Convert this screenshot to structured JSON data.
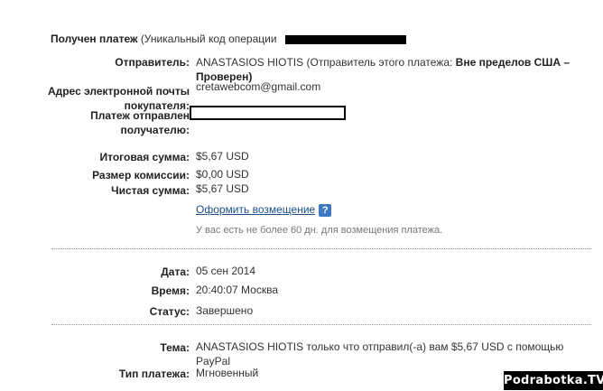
{
  "header": {
    "received": "Получен платеж",
    "unique_code": "(Уникальный код операции"
  },
  "sender": {
    "label": "Отправитель:",
    "name": "ANASTASIOS HIOTIS",
    "note_prefix": "(Отправитель этого платежа:",
    "status_bold_1": "Вне пределов США –",
    "status_bold_2": "Проверен)"
  },
  "email": {
    "label_line1": "Адрес электронной почты",
    "label_line2": "покупателя:",
    "value": "cretawebcom@gmail.com"
  },
  "sent_to": {
    "label_line1": "Платеж отправлен",
    "label_line2": "получателю:"
  },
  "amounts": {
    "total_label": "Итоговая сумма:",
    "total_value": "$5,67 USD",
    "fee_label": "Размер комиссии:",
    "fee_value": "$0,00 USD",
    "net_label": "Чистая сумма:",
    "net_value": "$5,67 USD"
  },
  "refund": {
    "link": "Оформить возмещение",
    "help_glyph": "?",
    "note": "У вас есть не более 60 дн. для возмещения платежа."
  },
  "details": {
    "date_label": "Дата:",
    "date_value": "05 сен 2014",
    "time_label": "Время:",
    "time_value": "20:40:07 Москва",
    "status_label": "Статус:",
    "status_value": "Завершено"
  },
  "subject": {
    "label": "Тема:",
    "line1": "ANASTASIOS HIOTIS только что отправил(-а) вам $5,67 USD с помощью",
    "line2": "PayPal"
  },
  "payment_type": {
    "label": "Тип платежа:",
    "value": "Мгновенный"
  },
  "watermark": "Podrabotka.TV"
}
